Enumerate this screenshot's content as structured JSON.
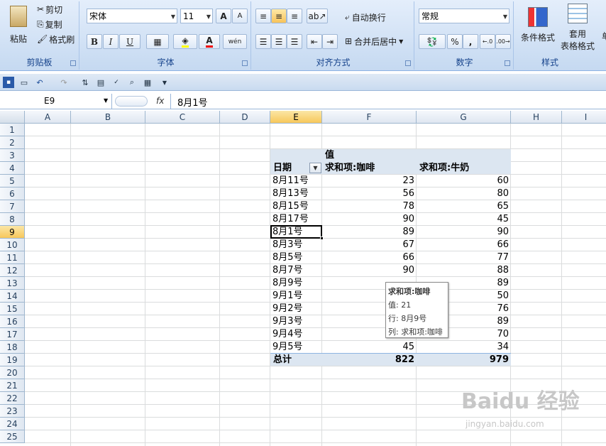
{
  "ribbon": {
    "clipboard": {
      "label": "剪贴板",
      "paste": "粘贴",
      "cut": "剪切",
      "copy": "复制",
      "format_painter": "格式刷"
    },
    "font": {
      "label": "字体",
      "name": "宋体",
      "size": "11",
      "bold": "B",
      "italic": "I",
      "underline": "U",
      "increase": "A",
      "decrease": "A",
      "wen": "wén"
    },
    "align": {
      "label": "对齐方式",
      "wrap": "自动换行",
      "merge": "合并后居中"
    },
    "number": {
      "label": "数字",
      "format": "常规",
      "percent": "%",
      "comma": ","
    },
    "styles": {
      "label": "样式",
      "cond": "条件格式",
      "table": "套用",
      "table2": "表格格式",
      "cell": "单"
    }
  },
  "formula_bar": {
    "name_box": "E9",
    "fx": "fx",
    "content": "8月1号"
  },
  "columns": [
    "A",
    "B",
    "C",
    "D",
    "E",
    "F",
    "G",
    "H",
    "I"
  ],
  "rows": [
    "1",
    "2",
    "3",
    "4",
    "5",
    "6",
    "7",
    "8",
    "9",
    "10",
    "11",
    "12",
    "13",
    "14",
    "15",
    "16",
    "17",
    "18",
    "19",
    "20",
    "21",
    "22",
    "23",
    "24",
    "25"
  ],
  "pivot": {
    "values_header": "值",
    "date_header": "日期",
    "col1_header": "求和项:咖啡",
    "col2_header": "求和项:牛奶",
    "rows": [
      {
        "date": "8月11号",
        "coffee": "23",
        "milk": "60"
      },
      {
        "date": "8月13号",
        "coffee": "56",
        "milk": "80"
      },
      {
        "date": "8月15号",
        "coffee": "78",
        "milk": "65"
      },
      {
        "date": "8月17号",
        "coffee": "90",
        "milk": "45"
      },
      {
        "date": "8月1号",
        "coffee": "89",
        "milk": "90"
      },
      {
        "date": "8月3号",
        "coffee": "67",
        "milk": "66"
      },
      {
        "date": "8月5号",
        "coffee": "66",
        "milk": "77"
      },
      {
        "date": "8月7号",
        "coffee": "90",
        "milk": "88"
      },
      {
        "date": "8月9号",
        "coffee": "",
        "milk": "89"
      },
      {
        "date": "9月1号",
        "coffee": "",
        "milk": "50"
      },
      {
        "date": "9月2号",
        "coffee": "",
        "milk": "76"
      },
      {
        "date": "9月3号",
        "coffee": "",
        "milk": "89"
      },
      {
        "date": "9月4号",
        "coffee": "",
        "milk": "70"
      },
      {
        "date": "9月5号",
        "coffee": "45",
        "milk": "34"
      }
    ],
    "total_label": "总计",
    "total_coffee": "822",
    "total_milk": "979"
  },
  "tooltip": {
    "title": "求和项:咖啡",
    "value": "值: 21",
    "row": "行: 8月9号",
    "col": "列: 求和项:咖啡"
  },
  "watermark": {
    "brand": "Baidu 经验",
    "url": "jingyan.baidu.com"
  }
}
